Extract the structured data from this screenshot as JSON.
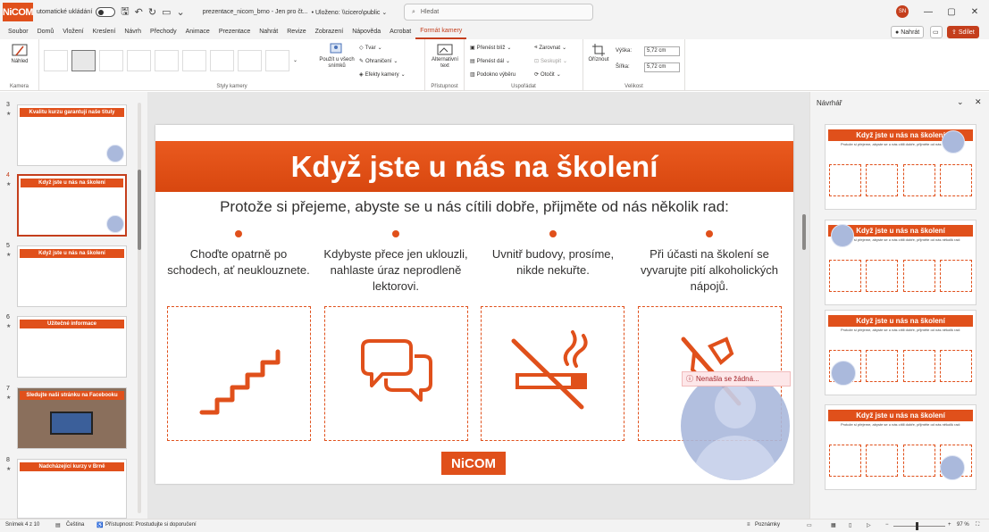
{
  "titlebar": {
    "logo": "NiCOM",
    "autosave_label": "utomatické ukládání",
    "filename": "prezentace_nicom_brno  -  Jen pro čt...",
    "saved": "•  Uloženo: \\\\cicero\\public  ⌄",
    "search_placeholder": "Hledat",
    "user_initials": "SN"
  },
  "menu": {
    "items": [
      "Soubor",
      "Domů",
      "Vložení",
      "Kreslení",
      "Návrh",
      "Přechody",
      "Animace",
      "Prezentace",
      "Nahrát",
      "Revize",
      "Zobrazení",
      "Nápověda",
      "Acrobat",
      "Formát kamery"
    ],
    "active": "Formát kamery",
    "record": "Nahrát",
    "share": "Sdílet"
  },
  "ribbon": {
    "camera_group": {
      "preview": "Náhled",
      "label": "Kamera"
    },
    "styles_group": {
      "label": "Styly kamery",
      "apply_all": "Použít u všech snímků"
    },
    "shape_items": [
      "Tvar",
      "Ohraničení",
      "Efekty kamery"
    ],
    "access_group": {
      "alt_text": "Alternativní text",
      "label": "Přístupnost"
    },
    "arrange_group": {
      "items": [
        "Přenést blíž",
        "Přenést dál",
        "Podokno výběru",
        "Zarovnat",
        "Seskupit",
        "Otočit"
      ],
      "label": "Uspořádat"
    },
    "size_group": {
      "crop": "Oříznout",
      "height_label": "Výška:",
      "height": "5,72 cm",
      "width_label": "Šířka:",
      "width": "5,72 cm",
      "label": "Velikost"
    }
  },
  "slides": [
    {
      "num": "3",
      "title": "Kvalitu kurzu garantují naše tituly"
    },
    {
      "num": "4",
      "title": "Když jste u nás na školení",
      "selected": true
    },
    {
      "num": "5",
      "title": "Když jste u nás na školení"
    },
    {
      "num": "6",
      "title": "Užitečné informace"
    },
    {
      "num": "7",
      "title": "Sledujte naši stránku na Facebooku"
    },
    {
      "num": "8",
      "title": "Nadcházející kurzy v Brně"
    }
  ],
  "slide": {
    "title": "Když jste u nás na školení",
    "subtitle": "Protože si přejeme, abyste se u nás cítili dobře, přijměte od nás několik rad:",
    "columns": [
      {
        "text": "Choďte opatrně po schodech, ať neuklouznete.",
        "icon": "stairs-icon"
      },
      {
        "text": "Kdybyste přece jen uklouzli, nahlaste úraz neprodleně lektorovi.",
        "icon": "chat-bubbles-icon"
      },
      {
        "text": "Uvnitř budovy, prosíme, nikde nekuřte.",
        "icon": "no-smoking-icon"
      },
      {
        "text": "Při účasti na školení se vyvarujte pití alkoholických nápojů.",
        "icon": "no-alcohol-icon"
      }
    ],
    "logo": "NiCOM",
    "camera_error": "Nenašla se žádná..."
  },
  "designer": {
    "title": "Návrhář",
    "thumb_title": "Když jste u nás na školení",
    "thumb_sub": "Protože si přejeme, abyste se u nás cítili dobře, přijměte od nás několik rad:"
  },
  "status": {
    "slide": "Snímek 4 z 10",
    "language": "Čeština",
    "accessibility": "Přístupnost: Prostudujte si doporučení",
    "notes": "Poznámky",
    "zoom": "97 %"
  },
  "colors": {
    "accent": "#e0501b",
    "office_red": "#c43e1c"
  }
}
